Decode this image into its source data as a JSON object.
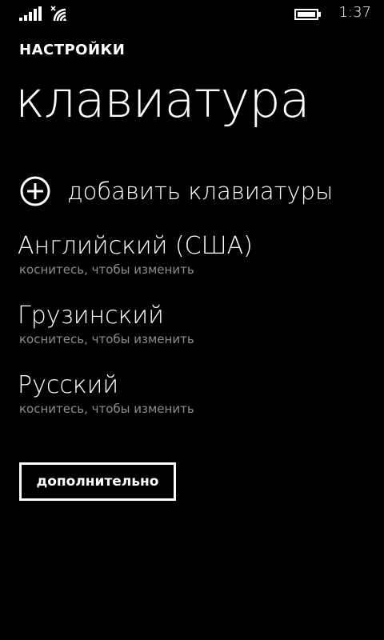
{
  "status_bar": {
    "time": "1:37",
    "icons": [
      "signal-icon",
      "wifi-icon",
      "battery-icon"
    ]
  },
  "header": {
    "app_title": "НАСТРОЙКИ",
    "page_title": "клавиатура"
  },
  "add_keyboards": {
    "icon": "plus-circle-icon",
    "label": "добавить клавиатуры"
  },
  "keyboards": [
    {
      "name": "Английский (США)",
      "hint": "коснитесь, чтобы изменить"
    },
    {
      "name": "Грузинский",
      "hint": "коснитесь, чтобы изменить"
    },
    {
      "name": "Русский",
      "hint": "коснитесь, чтобы изменить"
    }
  ],
  "more_button": {
    "label": "дополнительно"
  },
  "colors": {
    "background": "#000000",
    "foreground": "#ffffff",
    "hint": "#8c8c8c"
  }
}
